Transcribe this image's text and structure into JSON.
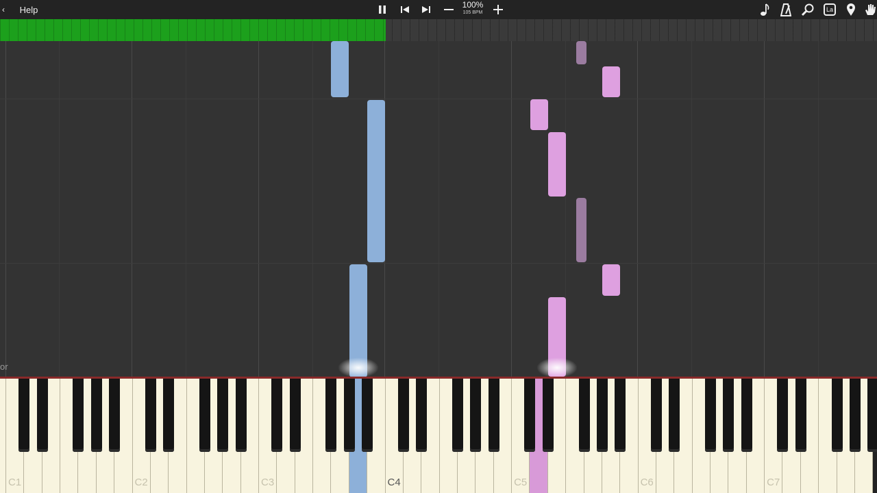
{
  "toolbar": {
    "back_label": "‹",
    "help_label": "Help",
    "speed_percent": "100%",
    "speed_bpm": "105 BPM",
    "label_icon_text": "La"
  },
  "icons": {
    "play_pause": "pause-icon",
    "skip_back": "skip-back-icon",
    "skip_forward": "skip-forward-icon",
    "speed_down": "minus-icon",
    "speed_up": "plus-icon",
    "note": "music-note-icon",
    "metronome": "metronome-icon",
    "search": "magnifier-icon",
    "label": "note-label-icon",
    "pin": "location-pin-icon",
    "hand": "hand-icon"
  },
  "progress": {
    "fraction": 0.44
  },
  "roll": {
    "left_label": "or"
  },
  "piano": {
    "octave_labels": [
      "C1",
      "C2",
      "C3",
      "C4",
      "C5",
      "C6",
      "C7"
    ]
  },
  "colors": {
    "right_hand_note": "#8db0d9",
    "left_hand_note": "#dea0e0",
    "progress_fill": "#1ca01c",
    "background": "#333333"
  }
}
